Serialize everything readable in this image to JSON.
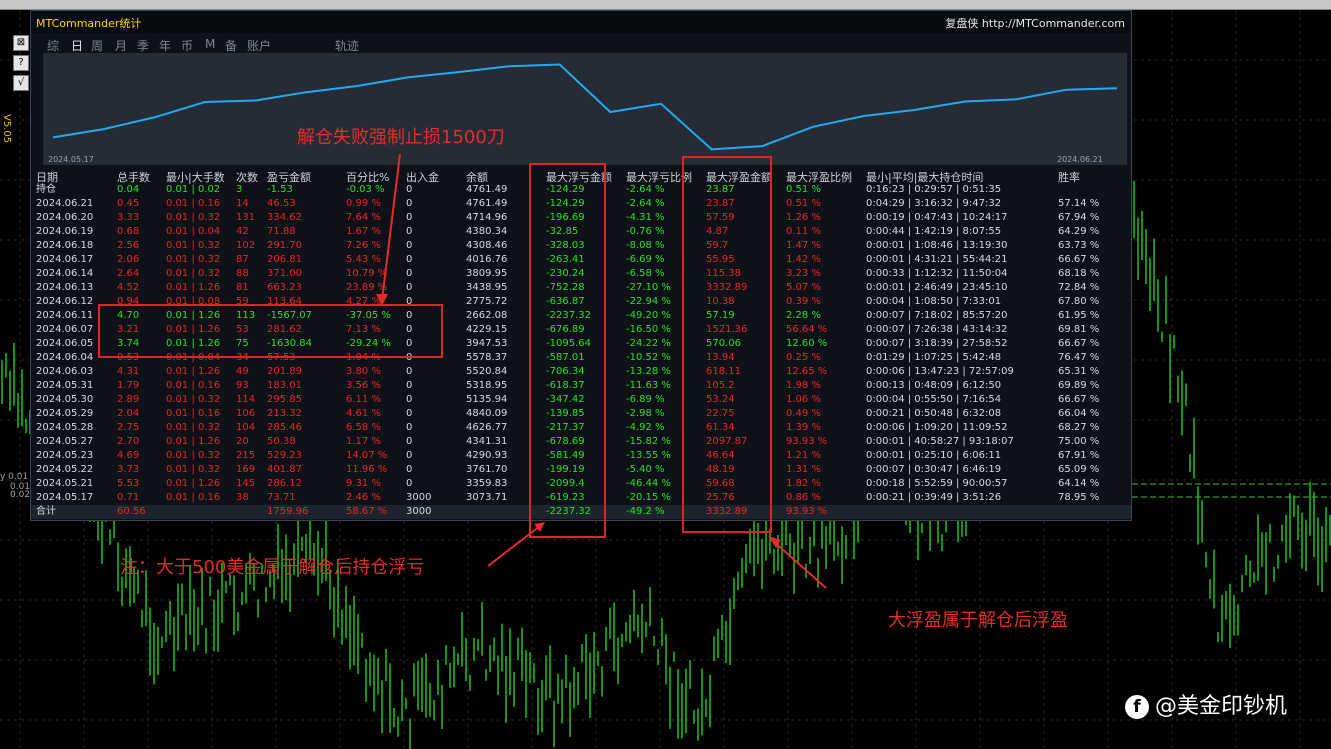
{
  "window": {
    "app_title": "MTCommander统计",
    "site_link": "复盘侠 http://MTCommander.com",
    "version": "V5.05",
    "left_labels": [
      "y 0.01",
      "0.01",
      "0.02"
    ]
  },
  "tabs": [
    "综",
    "日",
    "周",
    "月",
    "季",
    "年",
    "币",
    "M",
    "备",
    "账户",
    "轨迹"
  ],
  "active_tab": "日",
  "equity_chart": {
    "start_date": "2024.05.17",
    "end_date": "2024.06.21",
    "values": [
      3073.71,
      3359.83,
      3761.7,
      4290.93,
      4341.31,
      4626.77,
      4840.09,
      5135.94,
      5318.95,
      5520.84,
      5578.37,
      3947.53,
      4229.15,
      2662.08,
      2775.72,
      3438.95,
      3809.95,
      4016.76,
      4308.46,
      4380.34,
      4714.96,
      4761.49
    ]
  },
  "table": {
    "headers": [
      "日期",
      "总手数",
      "最小|大手数",
      "次数",
      "盈亏金额",
      "百分比%",
      "出入金",
      "余额",
      "最大浮亏金额",
      "最大浮亏比例",
      "最大浮盈金额",
      "最大浮盈比例",
      "最小|平均|最大持仓时间",
      "胜率"
    ],
    "holding": [
      "持仓",
      "0.04",
      "0.01 | 0.02",
      "3",
      "-1.53",
      "-0.03 %",
      "0",
      "4761.49",
      "-124.29",
      "-2.64 %",
      "23.87",
      "0.51 %",
      "0:16:23 | 0:29:57 | 0:51:35",
      ""
    ],
    "rows": [
      [
        "2024.06.21",
        "0.45",
        "0.01 | 0.16",
        "14",
        "46.53",
        "0.99 %",
        "0",
        "4761.49",
        "-124.29",
        "-2.64 %",
        "23.87",
        "0.51 %",
        "0:04:29 | 3:16:32 | 9:47:32",
        "57.14 %"
      ],
      [
        "2024.06.20",
        "3.33",
        "0.01 | 0.32",
        "131",
        "334.62",
        "7.64 %",
        "0",
        "4714.96",
        "-196.69",
        "-4.31 %",
        "57.59",
        "1.26 %",
        "0:00:19 | 0:47:43 | 10:24:17",
        "67.94 %"
      ],
      [
        "2024.06.19",
        "0.68",
        "0.01 | 0.04",
        "42",
        "71.88",
        "1.67 %",
        "0",
        "4380.34",
        "-32.85",
        "-0.76 %",
        "4.87",
        "0.11 %",
        "0:00:44 | 1:42:19 | 8:07:55",
        "64.29 %"
      ],
      [
        "2024.06.18",
        "2.56",
        "0.01 | 0.32",
        "102",
        "291.70",
        "7.26 %",
        "0",
        "4308.46",
        "-328.03",
        "-8.08 %",
        "59.7",
        "1.47 %",
        "0:00:01 | 1:08:46 | 13:19:30",
        "63.73 %"
      ],
      [
        "2024.06.17",
        "2.06",
        "0.01 | 0.32",
        "87",
        "206.81",
        "5.43 %",
        "0",
        "4016.76",
        "-263.41",
        "-6.69 %",
        "55.95",
        "1.42 %",
        "0:00:01 | 4:31:21 | 55:44:21",
        "66.67 %"
      ],
      [
        "2024.06.14",
        "2.64",
        "0.01 | 0.32",
        "88",
        "371.00",
        "10.79 %",
        "0",
        "3809.95",
        "-230.24",
        "-6.58 %",
        "115.38",
        "3.23 %",
        "0:00:33 | 1:12:32 | 11:50:04",
        "68.18 %"
      ],
      [
        "2024.06.13",
        "4.52",
        "0.01 | 1.26",
        "81",
        "663.23",
        "23.89 %",
        "0",
        "3438.95",
        "-752.28",
        "-27.10 %",
        "3332.89",
        "5.07 %",
        "0:00:01 | 2:46:49 | 23:45:10",
        "72.84 %"
      ],
      [
        "2024.06.12",
        "0.94",
        "0.01 | 0.08",
        "59",
        "113.64",
        "4.27 %",
        "0",
        "2775.72",
        "-636.87",
        "-22.94 %",
        "10.38",
        "0.39 %",
        "0:00:04 | 1:08:50 | 7:33:01",
        "67.80 %"
      ],
      [
        "2024.06.11",
        "4.70",
        "0.01 | 1.26",
        "113",
        "-1567.07",
        "-37.05 %",
        "0",
        "2662.08",
        "-2237.32",
        "-49.20 %",
        "57.19",
        "2.28 %",
        "0:00:07 | 7:18:02 | 85:57:20",
        "61.95 %"
      ],
      [
        "2024.06.07",
        "3.21",
        "0.01 | 1.26",
        "53",
        "281.62",
        "7.13 %",
        "0",
        "4229.15",
        "-676.89",
        "-16.50 %",
        "1521.36",
        "56.64 %",
        "0:00:07 | 7:26:38 | 43:14:32",
        "69.81 %"
      ],
      [
        "2024.06.05",
        "3.74",
        "0.01 | 1.26",
        "75",
        "-1630.84",
        "-29.24 %",
        "0",
        "3947.53",
        "-1095.64",
        "-24.22 %",
        "570.06",
        "12.60 %",
        "0:00:07 | 3:18:39 | 27:58:52",
        "66.67 %"
      ],
      [
        "2024.06.04",
        "0.53",
        "0.01 | 0.04",
        "34",
        "57.53",
        "1.04 %",
        "0",
        "5578.37",
        "-587.01",
        "-10.52 %",
        "13.94",
        "0.25 %",
        "0:01:29 | 1:07:25 | 5:42:48",
        "76.47 %"
      ],
      [
        "2024.06.03",
        "4.31",
        "0.01 | 1.26",
        "49",
        "201.89",
        "3.80 %",
        "0",
        "5520.84",
        "-706.34",
        "-13.28 %",
        "618.11",
        "12.65 %",
        "0:00:06 | 13:47:23 | 72:57:09",
        "65.31 %"
      ],
      [
        "2024.05.31",
        "1.79",
        "0.01 | 0.16",
        "93",
        "183.01",
        "3.56 %",
        "0",
        "5318.95",
        "-618.37",
        "-11.63 %",
        "105.2",
        "1.98 %",
        "0:00:13 | 0:48:09 | 6:12:50",
        "69.89 %"
      ],
      [
        "2024.05.30",
        "2.89",
        "0.01 | 0.32",
        "114",
        "295.85",
        "6.11 %",
        "0",
        "5135.94",
        "-347.42",
        "-6.89 %",
        "53.24",
        "1.06 %",
        "0:00:04 | 0:55:50 | 7:16:54",
        "66.67 %"
      ],
      [
        "2024.05.29",
        "2.04",
        "0.01 | 0.16",
        "106",
        "213.32",
        "4.61 %",
        "0",
        "4840.09",
        "-139.85",
        "-2.98 %",
        "22.75",
        "0.49 %",
        "0:00:21 | 0:50:48 | 6:32:08",
        "66.04 %"
      ],
      [
        "2024.05.28",
        "2.75",
        "0.01 | 0.32",
        "104",
        "285.46",
        "6.58 %",
        "0",
        "4626.77",
        "-217.37",
        "-4.92 %",
        "61.34",
        "1.39 %",
        "0:00:06 | 1:09:20 | 11:09:52",
        "68.27 %"
      ],
      [
        "2024.05.27",
        "2.70",
        "0.01 | 1.26",
        "20",
        "50.38",
        "1.17 %",
        "0",
        "4341.31",
        "-678.69",
        "-15.82 %",
        "2097.87",
        "93.93 %",
        "0:00:01 | 40:58:27 | 93:18:07",
        "75.00 %"
      ],
      [
        "2024.05.23",
        "4.69",
        "0.01 | 0.32",
        "215",
        "529.23",
        "14.07 %",
        "0",
        "4290.93",
        "-581.49",
        "-13.55 %",
        "46.64",
        "1.21 %",
        "0:00:01 | 0:25:10 | 6:06:11",
        "67.91 %"
      ],
      [
        "2024.05.22",
        "3.73",
        "0.01 | 0.32",
        "169",
        "401.87",
        "11.96 %",
        "0",
        "3761.70",
        "-199.19",
        "-5.40 %",
        "48.19",
        "1.31 %",
        "0:00:07 | 0:30:47 | 6:46:19",
        "65.09 %"
      ],
      [
        "2024.05.21",
        "5.53",
        "0.01 | 1.26",
        "145",
        "286.12",
        "9.31 %",
        "0",
        "3359.83",
        "-2099.4",
        "-46.44 %",
        "59.68",
        "1.82 %",
        "0:00:18 | 5:52:59 | 90:00:57",
        "64.14 %"
      ],
      [
        "2024.05.17",
        "0.71",
        "0.01 | 0.16",
        "38",
        "73.71",
        "2.46 %",
        "3000",
        "3073.71",
        "-619.23",
        "-20.15 %",
        "25.76",
        "0.86 %",
        "0:00:21 | 0:39:49 | 3:51:26",
        "78.95 %"
      ]
    ],
    "total": [
      "合计",
      "60.56",
      "",
      "",
      "1759.96",
      "58.67 %",
      "3000",
      "",
      "-2237.32",
      "-49.2 %",
      "3332.89",
      "93.93 %",
      "",
      ""
    ]
  },
  "colors": {
    "positive": "#e8262a",
    "negative": "#27e027",
    "neutral": "#d7dbe0",
    "equity_line": "#22a9f0",
    "annotation": "#e62b2b",
    "candle": "#1fd11f"
  },
  "annotations": {
    "top": "解仓失败强制止损1500刀",
    "left": "注：大于500美金属于解仓后持仓浮亏",
    "right": "大浮盈属于解仓后浮盈"
  },
  "watermark": "@美金印钞机"
}
